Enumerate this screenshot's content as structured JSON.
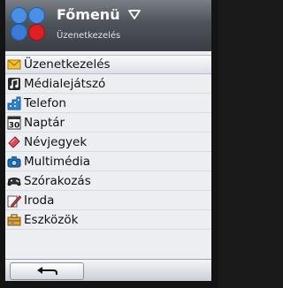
{
  "header": {
    "title": "Főmenü",
    "subtitle": "Üzenetkezelés",
    "logo_colors": [
      "#4a90e2",
      "#4a90e2",
      "#3b7bd6",
      "#e02020"
    ]
  },
  "menu": {
    "selected_index": 0,
    "items": [
      {
        "label": "Üzenetkezelés",
        "icon": "envelope-icon"
      },
      {
        "label": "Médialejátszó",
        "icon": "music-note-icon"
      },
      {
        "label": "Telefon",
        "icon": "building-icon"
      },
      {
        "label": "Naptár",
        "icon": "calendar-icon"
      },
      {
        "label": "Névjegyek",
        "icon": "contact-card-icon"
      },
      {
        "label": "Multimédia",
        "icon": "camera-icon"
      },
      {
        "label": "Szórakozás",
        "icon": "gamepad-icon"
      },
      {
        "label": "Iroda",
        "icon": "pencil-icon"
      },
      {
        "label": "Eszközök",
        "icon": "toolbox-icon"
      }
    ]
  },
  "calendar_icon_text": "30",
  "softkeys": {
    "left": {
      "icon": "back-arrow-icon"
    }
  },
  "colors": {
    "header_dark": "#3a3e44",
    "selection": "#dde1e7"
  }
}
